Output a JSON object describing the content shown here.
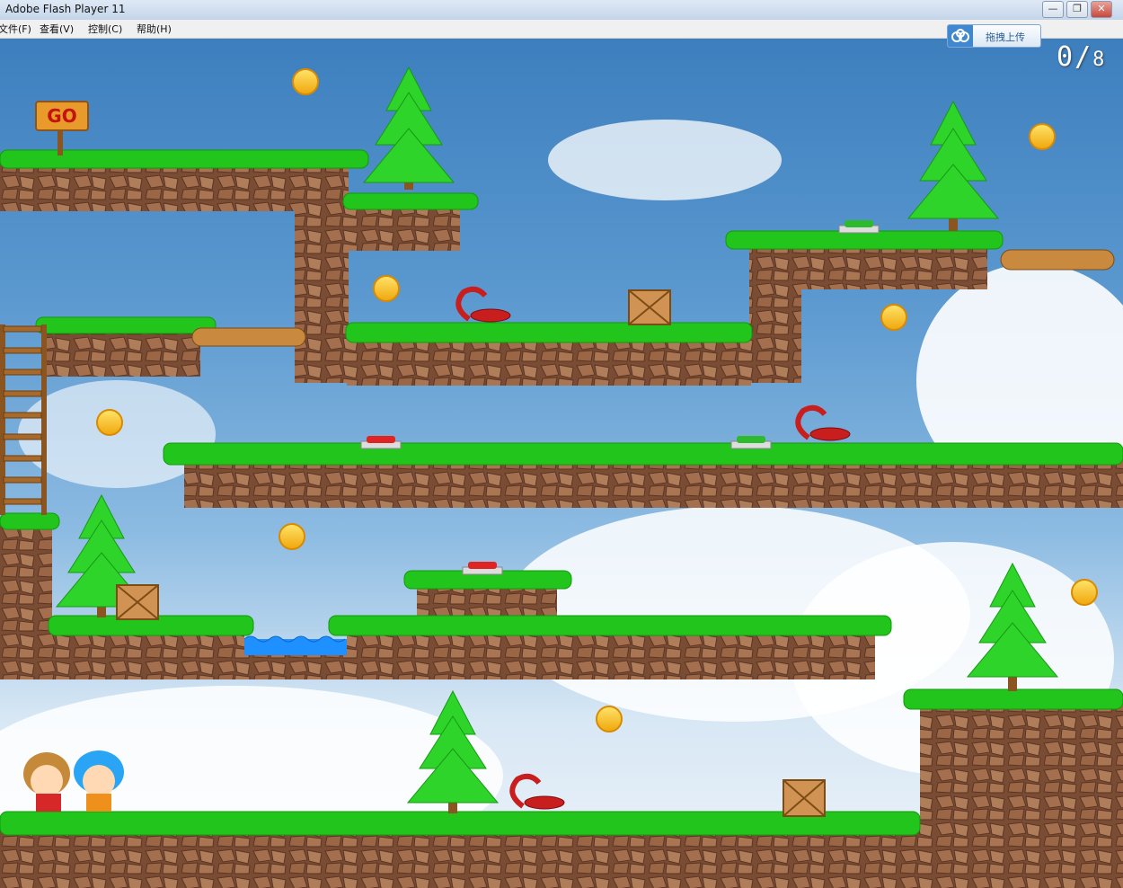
{
  "window": {
    "title": "Adobe Flash Player 11",
    "controls": [
      "—",
      "❐",
      "✕"
    ]
  },
  "menu": {
    "items": [
      "文件(F)",
      "查看(V)",
      "控制(C)",
      "帮助(H)"
    ]
  },
  "toolbar": {
    "upload_label": "拖拽上传"
  },
  "hud": {
    "collected": "0",
    "total": "8"
  },
  "sign": {
    "text": "GO"
  },
  "colors": {
    "grass": "#22c51b",
    "rock": "#8a5a3d",
    "sky_top": "#3d7fbe",
    "coin": "#f5b916",
    "water": "#1e90ff",
    "scorpion": "#c81e1e"
  }
}
